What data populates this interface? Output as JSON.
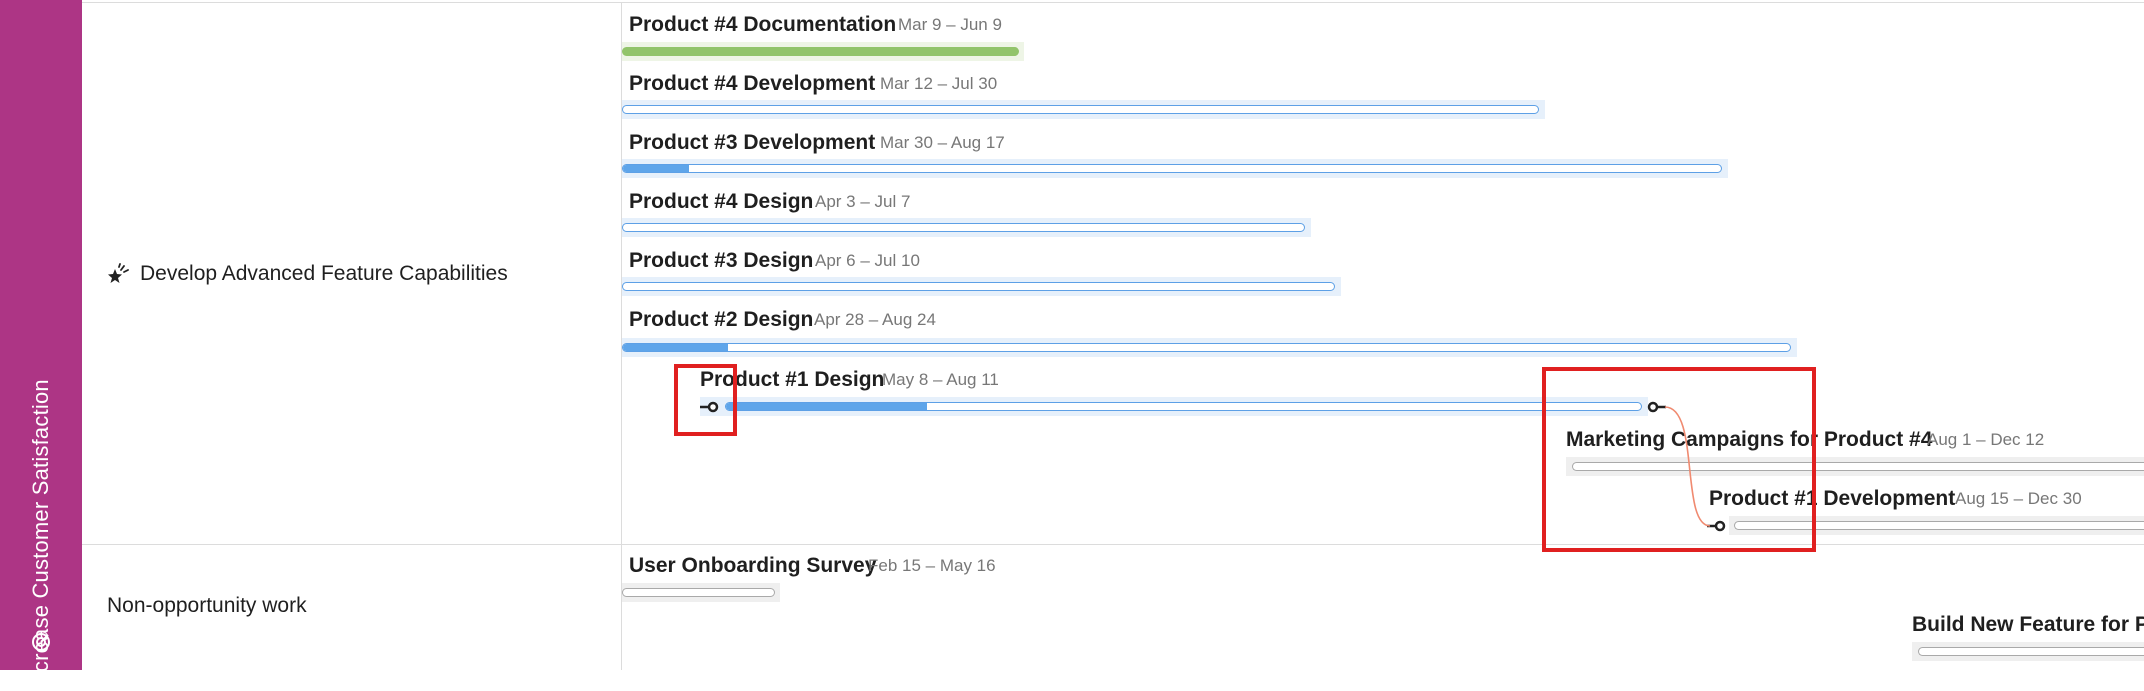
{
  "swimlane": {
    "title": "Increase Customer Satisfaction",
    "icon": "target-icon",
    "color": "#ad3585"
  },
  "groups": [
    {
      "label": "Develop Advanced Feature Capabilities",
      "icon": "feature-star-icon"
    },
    {
      "label": "Non-opportunity work"
    }
  ],
  "bars": [
    {
      "title": "Product #4 Documentation",
      "dates": "Mar 9 – Jun 9",
      "progress": 1.0,
      "style": "green"
    },
    {
      "title": "Product #4 Development",
      "dates": "Mar 12 – Jul 30",
      "progress": 0.0,
      "style": "blue"
    },
    {
      "title": "Product #3 Development",
      "dates": "Mar 30 – Aug 17",
      "progress": 0.06,
      "style": "blue"
    },
    {
      "title": "Product #4 Design",
      "dates": "Apr 3 – Jul 7",
      "progress": 0.0,
      "style": "blue"
    },
    {
      "title": "Product #3 Design",
      "dates": "Apr 6 – Jul 10",
      "progress": 0.0,
      "style": "blue"
    },
    {
      "title": "Product #2 Design",
      "dates": "Apr 28 – Aug 24",
      "progress": 0.09,
      "style": "blue"
    },
    {
      "title": "Product #1 Design",
      "dates": "May 8 – Aug 11",
      "progress": 0.22,
      "style": "blue"
    },
    {
      "title": "Marketing Campaigns for Product #4",
      "dates": "Aug 1 – Dec 12",
      "progress": 0.0,
      "style": "grey"
    },
    {
      "title": "Product #1 Development",
      "dates": "Aug 15 – Dec 30",
      "progress": 0.0,
      "style": "grey"
    },
    {
      "title": "User Onboarding Survey",
      "dates": "Feb 15 – May 16",
      "progress": 0.0,
      "style": "grey"
    },
    {
      "title": "Build New Feature for Pr",
      "dates": "",
      "progress": 0.0,
      "style": "grey"
    }
  ],
  "dependency": {
    "from": "Product #1 Design",
    "to": "Product #1 Development",
    "color": "#f08a70"
  },
  "highlight_color": "#e02020"
}
